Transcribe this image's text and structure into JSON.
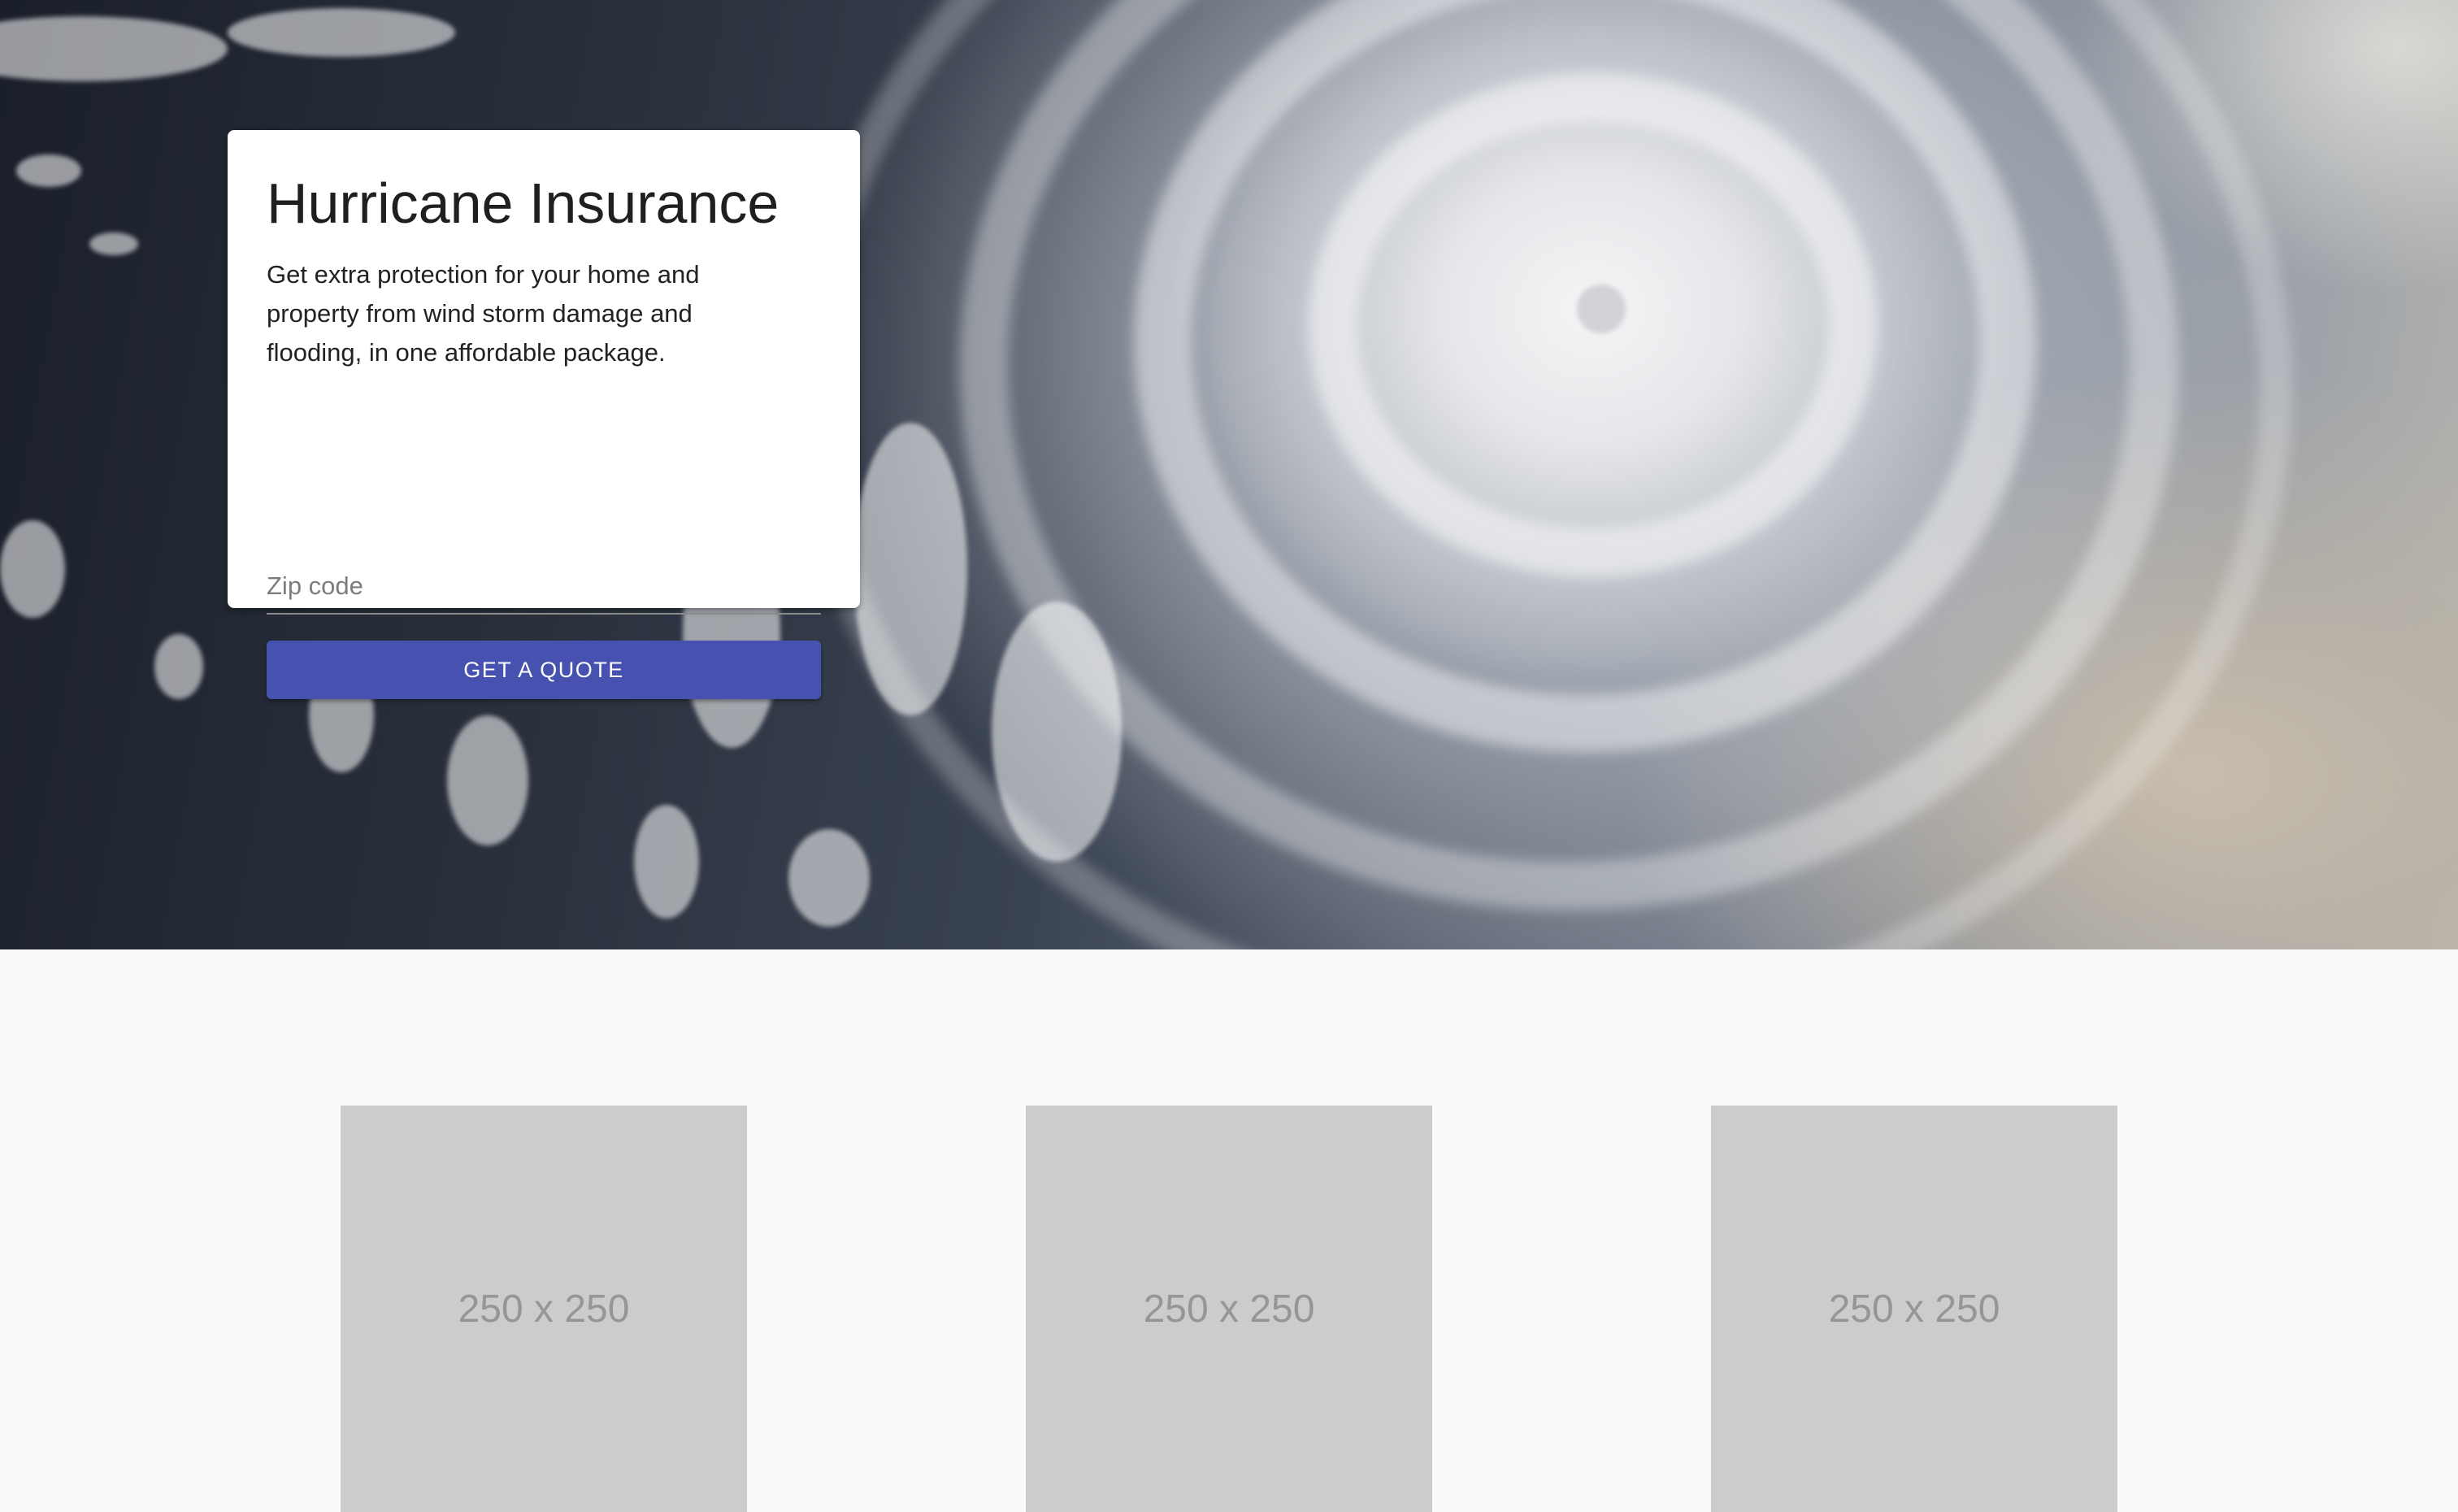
{
  "hero": {
    "title": "Hurricane Insurance",
    "description": "Get extra protection for your home and property from wind storm damage and flooding, in one affordable package.",
    "zip_placeholder": "Zip code",
    "zip_value": "",
    "cta_label": "GET A QUOTE"
  },
  "colors": {
    "accent": "#4651b0",
    "page_background": "#fafafa",
    "placeholder_box": "#cccccc"
  },
  "placeholders": [
    {
      "label": "250 x 250"
    },
    {
      "label": "250 x 250"
    },
    {
      "label": "250 x 250"
    }
  ]
}
